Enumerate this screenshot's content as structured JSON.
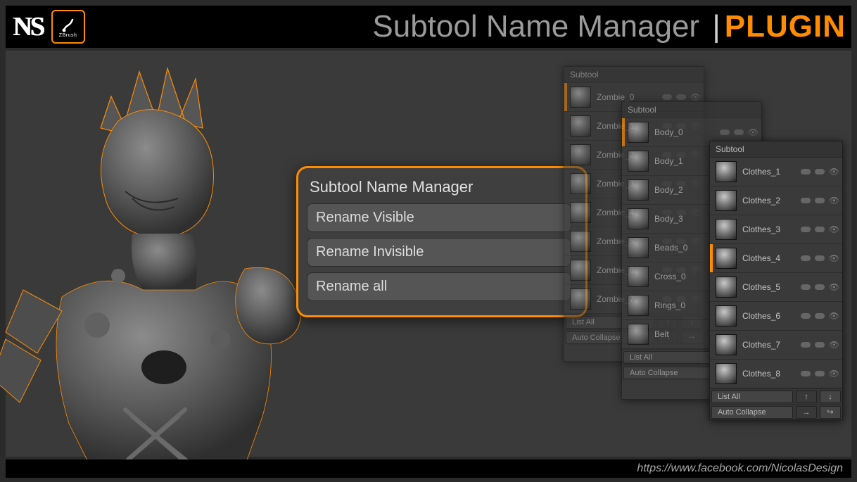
{
  "banner": {
    "logo_ns": "NS",
    "zbrush_label": "ZBrush",
    "title_main": "Subtool Name Manager",
    "title_sep": "|",
    "title_plugin": "PLUGIN"
  },
  "dialog": {
    "title": "Subtool Name Manager",
    "buttons": [
      "Rename Visible",
      "Rename Invisible",
      "Rename all"
    ]
  },
  "panels": {
    "header": "Subtool",
    "back": {
      "items": [
        "Zombie_0",
        "Zombie_1",
        "Zombie_2",
        "Zombie_3",
        "Zombie_4",
        "Zombie_5",
        "Zombie_6",
        "Zombie_7"
      ]
    },
    "mid": {
      "items": [
        "Body_0",
        "Body_1",
        "Body_2",
        "Body_3",
        "Beads_0",
        "Cross_0",
        "Rings_0",
        "Belt"
      ]
    },
    "front": {
      "items": [
        "Clothes_1",
        "Clothes_2",
        "Clothes_3",
        "Clothes_4",
        "Clothes_5",
        "Clothes_6",
        "Clothes_7",
        "Clothes_8"
      ]
    },
    "footer": {
      "list_all": "List All",
      "auto_collapse": "Auto Collapse",
      "arrow_up": "↑",
      "arrow_down": "↓",
      "arrow_right": "↪",
      "arrow_fwd": "→"
    }
  },
  "footer": {
    "url": "https://www.facebook.com/NicolasDesign"
  }
}
